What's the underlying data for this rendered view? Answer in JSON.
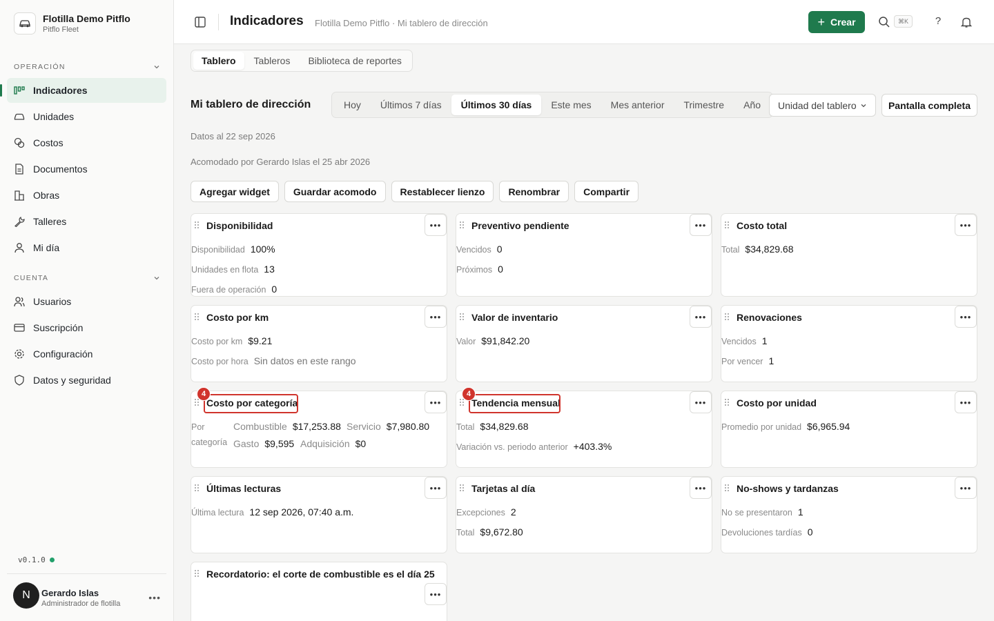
{
  "org": {
    "name": "Flotilla Demo Pitflo",
    "subtitle": "Pitflo Fleet"
  },
  "sidebar": {
    "section_operacion": "OPERACIÓN",
    "section_cuenta": "CUENTA",
    "operacion_items": [
      {
        "label": "Indicadores",
        "icon": "chart-icon"
      },
      {
        "label": "Unidades",
        "icon": "car-icon"
      },
      {
        "label": "Costos",
        "icon": "coins-icon"
      },
      {
        "label": "Documentos",
        "icon": "document-icon"
      },
      {
        "label": "Obras",
        "icon": "building-icon"
      },
      {
        "label": "Talleres",
        "icon": "wrench-icon"
      },
      {
        "label": "Mi día",
        "icon": "user-icon"
      }
    ],
    "cuenta_items": [
      {
        "label": "Usuarios",
        "icon": "users-icon"
      },
      {
        "label": "Suscripción",
        "icon": "card-icon"
      },
      {
        "label": "Configuración",
        "icon": "gear-icon"
      },
      {
        "label": "Datos y seguridad",
        "icon": "shield-icon"
      }
    ],
    "version": "v0.1.0",
    "user": {
      "initial": "N",
      "name": "Gerardo Islas",
      "role": "Administrador de flotilla"
    }
  },
  "topbar": {
    "title": "Indicadores",
    "breadcrumb": "Flotilla Demo Pitflo · Mi tablero de dirección",
    "create_label": "Crear",
    "shortcut": "⌘K",
    "help": "?"
  },
  "tabs": [
    "Tablero",
    "Tableros",
    "Biblioteca de reportes"
  ],
  "dashboard": {
    "title": "Mi tablero de dirección",
    "ranges": [
      "Hoy",
      "Últimos 7 días",
      "Últimos 30 días",
      "Este mes",
      "Mes anterior",
      "Trimestre",
      "Año"
    ],
    "active_range": "Últimos 30 días",
    "unit_select": "Unidad del tablero",
    "fullscreen": "Pantalla completa",
    "data_as_of": "Datos al 22 sep 2026",
    "arranged_by": "Acomodado por Gerardo Islas el 25 abr 2026",
    "actions": [
      "Agregar widget",
      "Guardar acomodo",
      "Restablecer lienzo",
      "Renombrar",
      "Compartir"
    ]
  },
  "widgets": {
    "disponibilidad": {
      "title": "Disponibilidad",
      "rows": [
        {
          "k": "Disponibilidad",
          "v": "100%"
        },
        {
          "k": "Unidades en flota",
          "v": "13"
        },
        {
          "k": "Fuera de operación",
          "v": "0"
        }
      ]
    },
    "preventivo": {
      "title": "Preventivo pendiente",
      "rows": [
        {
          "k": "Vencidos",
          "v": "0"
        },
        {
          "k": "Próximos",
          "v": "0"
        }
      ]
    },
    "costo_total": {
      "title": "Costo total",
      "rows": [
        {
          "k": "Total",
          "v": "$34,829.68"
        }
      ]
    },
    "costo_km": {
      "title": "Costo por km",
      "rows": [
        {
          "k": "Costo por km",
          "v": "$9.21"
        },
        {
          "k": "Costo por hora",
          "v": "Sin datos en este rango"
        }
      ]
    },
    "inventario": {
      "title": "Valor de inventario",
      "rows": [
        {
          "k": "Valor",
          "v": "$91,842.20"
        }
      ]
    },
    "renovaciones": {
      "title": "Renovaciones",
      "rows": [
        {
          "k": "Vencidos",
          "v": "1"
        },
        {
          "k": "Por vencer",
          "v": "1"
        }
      ]
    },
    "costo_categoria": {
      "title": "Costo por categoría",
      "label_1": "Por",
      "label_2": "categoría",
      "badge": "4",
      "items": [
        {
          "k": "Combustible",
          "v": "$17,253.88"
        },
        {
          "k": "Servicio",
          "v": "$7,980.80"
        },
        {
          "k": "Gasto",
          "v": "$9,595"
        },
        {
          "k": "Adquisición",
          "v": "$0"
        }
      ]
    },
    "tendencia": {
      "title": "Tendencia mensual",
      "badge": "4",
      "rows": [
        {
          "k": "Total",
          "v": "$34,829.68"
        },
        {
          "k": "Variación vs. periodo anterior",
          "v": "+403.3%"
        }
      ]
    },
    "costo_unidad": {
      "title": "Costo por unidad",
      "rows": [
        {
          "k": "Promedio por unidad",
          "v": "$6,965.94"
        }
      ]
    },
    "lecturas": {
      "title": "Últimas lecturas",
      "rows": [
        {
          "k": "Última lectura",
          "v": "12 sep 2026, 07:40 a.m."
        }
      ]
    },
    "tarjetas": {
      "title": "Tarjetas al día",
      "rows": [
        {
          "k": "Excepciones",
          "v": "2"
        },
        {
          "k": "Total",
          "v": "$9,672.80"
        }
      ]
    },
    "noshows": {
      "title": "No-shows y tardanzas",
      "rows": [
        {
          "k": "No se presentaron",
          "v": "1"
        },
        {
          "k": "Devoluciones tardías",
          "v": "0"
        }
      ]
    },
    "recordatorio": {
      "title": "Recordatorio: el corte de combustible es el día 25"
    }
  },
  "colors": {
    "accent": "#1f7a4d",
    "highlight": "#d0342c",
    "active_bg": "#e8f2ec"
  }
}
